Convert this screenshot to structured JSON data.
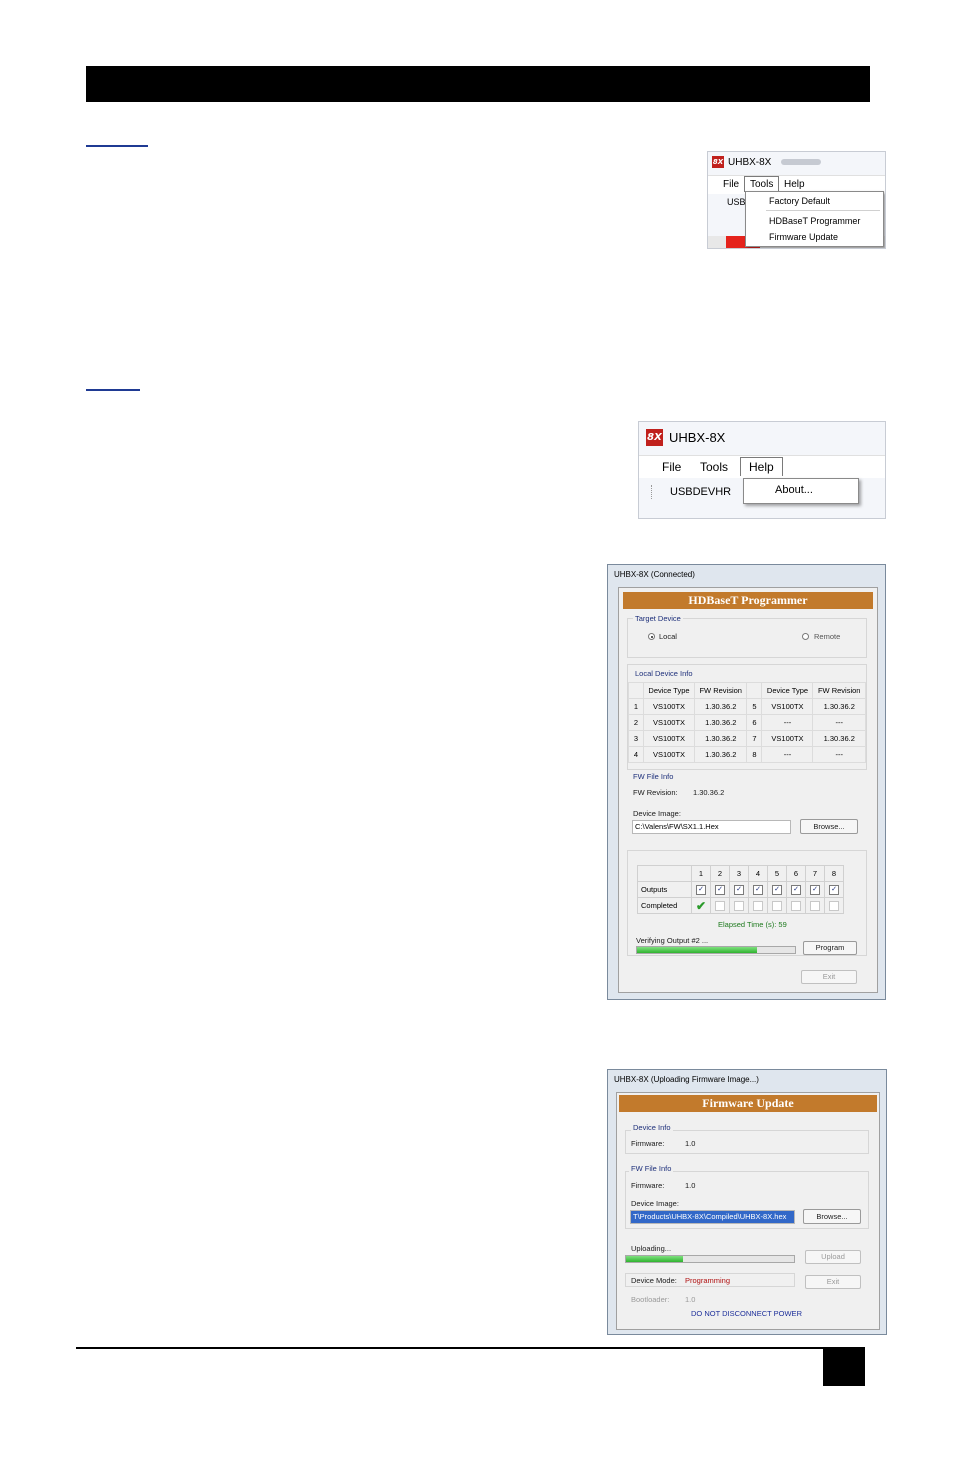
{
  "shot_tools": {
    "app_title": "UHBX-8X",
    "logo": "8X",
    "menu": [
      "File",
      "Tools",
      "Help"
    ],
    "toolbar_partial": "USB",
    "dropdown": [
      "Factory Default",
      "HDBaseT Programmer",
      "Firmware Update"
    ]
  },
  "shot_help": {
    "app_title": "UHBX-8X",
    "logo": "8X",
    "menu": [
      "File",
      "Tools",
      "Help"
    ],
    "toolbar_label": "USBDEVHR",
    "dropdown": [
      "About..."
    ]
  },
  "hdbaset": {
    "window_title": "UHBX-8X (Connected)",
    "banner": "HDBaseT Programmer",
    "target_label": "Target Device",
    "local_label": "Local",
    "remote_label": "Remote",
    "selected_target": "Local",
    "local_info_label": "Local Device Info",
    "headers": [
      "",
      "Device Type",
      "FW Revision",
      "",
      "Device Type",
      "FW Revision"
    ],
    "rows": [
      [
        "1",
        "VS100TX",
        "1.30.36.2",
        "5",
        "VS100TX",
        "1.30.36.2"
      ],
      [
        "2",
        "VS100TX",
        "1.30.36.2",
        "6",
        "---",
        "---"
      ],
      [
        "3",
        "VS100TX",
        "1.30.36.2",
        "7",
        "VS100TX",
        "1.30.36.2"
      ],
      [
        "4",
        "VS100TX",
        "1.30.36.2",
        "8",
        "---",
        "---"
      ]
    ],
    "fw_file_label": "FW File Info",
    "fw_revision_label": "FW Revision:",
    "fw_revision_value": "1.30.36.2",
    "device_image_label": "Device Image:",
    "device_image_value": "C:\\Valens\\FW\\SX1.1.Hex",
    "browse": "Browse...",
    "output_numbers": [
      "1",
      "2",
      "3",
      "4",
      "5",
      "6",
      "7",
      "8"
    ],
    "outputs_label": "Outputs",
    "completed_label": "Completed",
    "outputs_checked": [
      true,
      true,
      true,
      true,
      true,
      true,
      true,
      true
    ],
    "completed_checked": [
      true,
      false,
      false,
      false,
      false,
      false,
      false,
      false
    ],
    "elapsed": "Elapsed Time (s): 59",
    "status": "Verifying Output #2 ...",
    "progress": 0.76,
    "program": "Program",
    "exit": "Exit",
    "colors": {
      "banner": "#c27a2c",
      "elapsed": "#1e7a1e",
      "progress": "#2fb32f"
    }
  },
  "firmware": {
    "window_title": "UHBX-8X (Uploading Firmware Image...)",
    "banner": "Firmware Update",
    "device_info_label": "Device Info",
    "firmware_label": "Firmware:",
    "device_firmware": "1.0",
    "fw_file_label": "FW File Info",
    "file_firmware": "1.0",
    "device_image_label": "Device Image:",
    "device_image_value": "T\\Products\\UHBX-8X\\Compiled\\UHBX-8X.hex",
    "browse": "Browse...",
    "uploading_label": "Uploading...",
    "progress": 0.34,
    "upload": "Upload",
    "device_mode_label": "Device Mode:",
    "device_mode_value": "Programming",
    "exit": "Exit",
    "bootloader_label": "Bootloader:",
    "bootloader_value": "1.0",
    "warning": "DO NOT DISCONNECT POWER",
    "colors": {
      "mode": "#b01010",
      "warning": "#1d2f9a"
    }
  }
}
